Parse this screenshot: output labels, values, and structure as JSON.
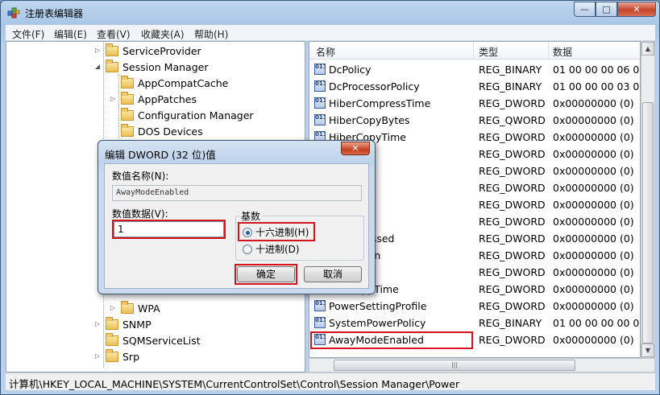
{
  "window": {
    "title": "注册表编辑器",
    "controls": {
      "minimize": "—",
      "maximize": "□",
      "close": "✕"
    }
  },
  "menubar": [
    "文件(F)",
    "编辑(E)",
    "查看(V)",
    "收藏夹(A)",
    "帮助(H)"
  ],
  "tree": {
    "items": [
      {
        "label": "ServiceProvider",
        "expander": "▷"
      },
      {
        "label": "Session Manager",
        "expander": "◢"
      },
      {
        "label": "AppCompatCache",
        "expander": ""
      },
      {
        "label": "AppPatches",
        "expander": "▷"
      },
      {
        "label": "Configuration Manager",
        "expander": ""
      },
      {
        "label": "DOS Devices",
        "expander": ""
      },
      {
        "label": "WPA",
        "expander": "▷"
      },
      {
        "label": "SNMP",
        "expander": "▷"
      },
      {
        "label": "SQMServiceList",
        "expander": ""
      },
      {
        "label": "Srp",
        "expander": "▷"
      }
    ]
  },
  "list": {
    "columns": [
      "名称",
      "类型",
      "数据"
    ],
    "rows": [
      {
        "name": "DcPolicy",
        "type": "REG_BINARY",
        "data": "01 00 00 00 06 00"
      },
      {
        "name": "DcProcessorPolicy",
        "type": "REG_BINARY",
        "data": "01 00 00 00 03 00"
      },
      {
        "name": "HiberCompressTime",
        "type": "REG_DWORD",
        "data": "0x00000000 (0)"
      },
      {
        "name": "HiberCopyBytes",
        "type": "REG_QWORD",
        "data": "0x00000000 (0)"
      },
      {
        "name": "HiberCopyTime",
        "type": "REG_DWORD",
        "data": "0x00000000 (0)"
      },
      {
        "name": "...pCount",
        "type": "REG_DWORD",
        "data": "0x00000000 (0)"
      },
      {
        "name": "...edTime",
        "type": "REG_DWORD",
        "data": "0x00000000 (0)"
      },
      {
        "name": "...uns",
        "type": "REG_DWORD",
        "data": "0x00000000 (0)"
      },
      {
        "name": "...me",
        "type": "REG_DWORD",
        "data": "0x00000000 (0)"
      },
      {
        "name": "...e",
        "type": "REG_DWORD",
        "data": "0x00000000 (0)"
      },
      {
        "name": "...sProcessed",
        "type": "REG_DWORD",
        "data": "0x00000000 (0)"
      },
      {
        "name": "...sWritten",
        "type": "REG_DWORD",
        "data": "0x00000000 (0)"
      },
      {
        "name": "...Time",
        "type": "REG_DWORD",
        "data": "0x00000000 (0)"
      },
      {
        "name": "...meAppTime",
        "type": "REG_DWORD",
        "data": "0x00000000 (0)"
      },
      {
        "name": "PowerSettingProfile",
        "type": "REG_DWORD",
        "data": "0x00000000 (0)"
      },
      {
        "name": "SystemPowerPolicy",
        "type": "REG_BINARY",
        "data": "01 00 00 00 00 00"
      },
      {
        "name": "AwayModeEnabled",
        "type": "REG_DWORD",
        "data": "0x00000000 (0)"
      }
    ],
    "icon_text": "011 110"
  },
  "status": {
    "path": "计算机\\HKEY_LOCAL_MACHINE\\SYSTEM\\CurrentControlSet\\Control\\Session Manager\\Power"
  },
  "dialog": {
    "title": "编辑 DWORD (32 位)值",
    "close": "✕",
    "name_label": "数值名称(N):",
    "name_value": "AwayModeEnabled",
    "data_label": "数值数据(V):",
    "data_value": "1",
    "base_label": "基数",
    "hex_label": "十六进制(H)",
    "dec_label": "十进制(D)",
    "ok": "确定",
    "cancel": "取消"
  },
  "colors": {
    "highlight_box": "#d4141c",
    "title_bar": "#bfd6ee"
  }
}
